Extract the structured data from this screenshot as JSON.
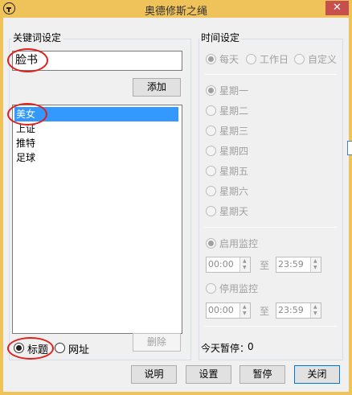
{
  "window": {
    "title": "奥德修斯之绳",
    "close_glyph": "✕"
  },
  "keywords": {
    "group_title": "关键词设定",
    "input_value": "脸书",
    "add_label": "添加",
    "items": [
      "美女",
      "上证",
      "推特",
      "足球"
    ],
    "selected_index": 0,
    "delete_label": "删除",
    "match_options": [
      "标题",
      "网址"
    ],
    "match_selected": "标题"
  },
  "time": {
    "group_title": "时间设定",
    "period_options": [
      "每天",
      "工作日",
      "自定义"
    ],
    "period_selected": "每天",
    "weekdays": [
      "星期一",
      "星期二",
      "星期三",
      "星期四",
      "星期五",
      "星期六",
      "星期天"
    ],
    "weekday_selected": "星期一",
    "start_label": "启用监控",
    "start_from": "00:00",
    "start_to": "23:59",
    "stop_label": "停用监控",
    "stop_from": "00:00",
    "stop_to": "23:59",
    "to_label": "至",
    "pause_label": "今天暂停：",
    "pause_count": "0"
  },
  "buttons": {
    "help": "说明",
    "settings": "设置",
    "pause": "暂停",
    "close": "关闭"
  },
  "colors": {
    "titlebar": "#f0c35a",
    "selection": "#3399ff",
    "annotation": "#e0201e",
    "close_button": "#c7504c"
  }
}
